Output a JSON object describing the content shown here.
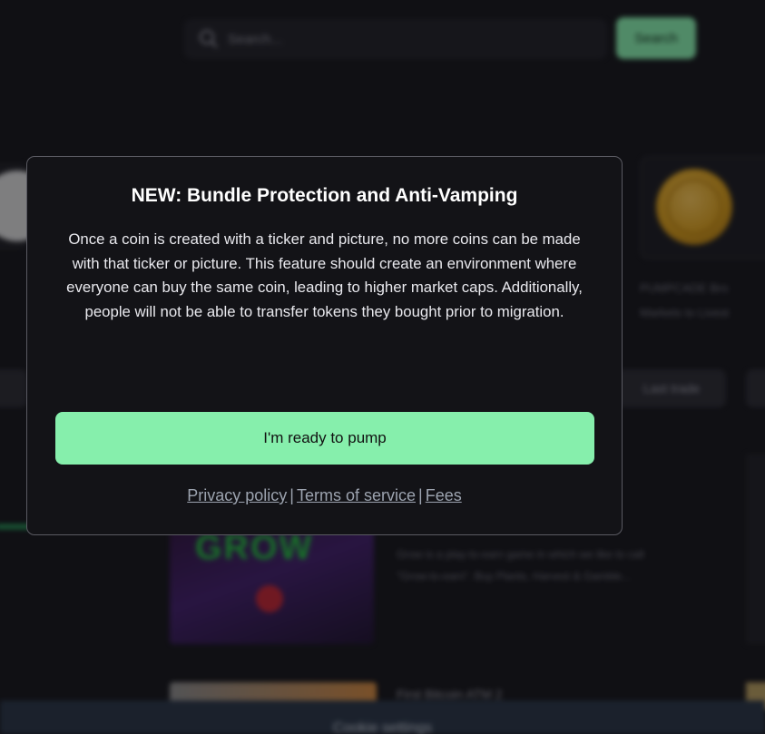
{
  "header": {
    "search_placeholder": "Search...",
    "search_button": "Search"
  },
  "background": {
    "featured_title_line1": "PUMPCADE Bro",
    "featured_title_line2": "Markets to Livest",
    "last_trade_label": "Last trade",
    "grow_image_word": "GROW",
    "grow_description_line1": "Grow is a play-to-earn game in which we like to call",
    "grow_description_line2": "\"Grow-to-earn\". Buy Plants, Harvest & Gamble...",
    "next_coin_title": "First Bitcoin ATM 2",
    "cookie_settings": "Cookie settings"
  },
  "modal": {
    "title": "NEW: Bundle Protection and Anti-Vamping",
    "body": "Once a coin is created with a ticker and picture, no more coins can be made with that ticker or picture. This feature should create an environment where everyone can buy the same coin, leading to higher market caps. Additionally, people will not be able to transfer tokens they bought prior to migration.",
    "primary_button": "I'm ready to pump",
    "links": {
      "privacy": "Privacy policy",
      "terms": "Terms of service",
      "fees": "Fees",
      "separator": "|"
    }
  },
  "colors": {
    "accent_green": "#86efac",
    "modal_bg": "#131317",
    "page_bg": "#101014"
  }
}
